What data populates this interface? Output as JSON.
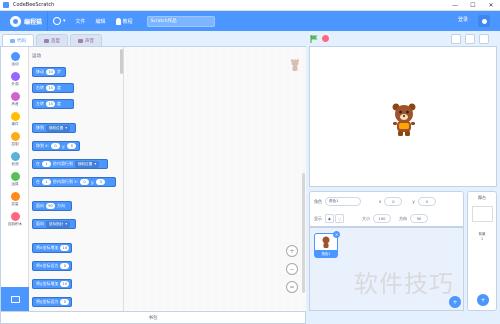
{
  "window": {
    "title": "CodeBeeScratch",
    "min": "—",
    "max": "☐",
    "close": "✕"
  },
  "menubar": {
    "logo_text": "编程猫",
    "items": [
      {
        "label": "文件"
      },
      {
        "label": "编辑"
      },
      {
        "label": "教程"
      }
    ],
    "project_title": "Scratch作品",
    "login": "登录"
  },
  "tabs": [
    {
      "label": "代码",
      "active": true
    },
    {
      "label": "造型",
      "active": false
    },
    {
      "label": "声音",
      "active": false
    }
  ],
  "categories": [
    {
      "label": "运动",
      "color": "#4c97ff"
    },
    {
      "label": "外观",
      "color": "#9966ff"
    },
    {
      "label": "声音",
      "color": "#cf63cf"
    },
    {
      "label": "事件",
      "color": "#ffbf00"
    },
    {
      "label": "控制",
      "color": "#ffab19"
    },
    {
      "label": "侦测",
      "color": "#5cb1d6"
    },
    {
      "label": "运算",
      "color": "#59c059"
    },
    {
      "label": "变量",
      "color": "#ff8c1a"
    },
    {
      "label": "自制积木",
      "color": "#ff6680"
    }
  ],
  "flyout": {
    "heading": "运动",
    "blocks": [
      {
        "pre": "移动",
        "val": "10",
        "post": "步"
      },
      {
        "pre": "右转",
        "val": "15",
        "post": "度"
      },
      {
        "pre": "左转",
        "val": "15",
        "post": "度"
      },
      {
        "pre": "移到",
        "dd": "随机位置"
      },
      {
        "pre": "移到 x:",
        "val": "0",
        "mid": "y:",
        "val2": "0"
      },
      {
        "pre": "在",
        "val": "1",
        "mid": "秒内滑行到",
        "dd": "随机位置"
      },
      {
        "pre": "在",
        "val": "1",
        "mid": "秒内滑行到 x:",
        "val2": "0",
        "post": "y:",
        "val3": "0"
      },
      {
        "pre": "面向",
        "val": "90",
        "post": "方向"
      },
      {
        "pre": "面向",
        "dd": "鼠标指针"
      },
      {
        "pre": "将x坐标增加",
        "val": "10"
      },
      {
        "pre": "将x坐标设为",
        "val": "0"
      },
      {
        "pre": "将y坐标增加",
        "val": "10"
      },
      {
        "pre": "将y坐标设为",
        "val": "0"
      }
    ]
  },
  "workspace": {
    "zoom_in": "+",
    "zoom_out": "−",
    "reset": "="
  },
  "backpack": {
    "label": "书包"
  },
  "sprite_info": {
    "sprite_label": "角色",
    "sprite_name": "角色1",
    "x_label": "x",
    "x_value": "0",
    "y_label": "y",
    "y_value": "0",
    "show_label": "显示",
    "size_label": "大小",
    "size_value": "100",
    "direction_label": "方向",
    "direction_value": "90"
  },
  "sprites": [
    {
      "name": "角色1"
    }
  ],
  "stage_pane": {
    "title": "舞台",
    "backdrop_label": "背景",
    "backdrop_count": "1"
  },
  "watermark": "软件技巧"
}
